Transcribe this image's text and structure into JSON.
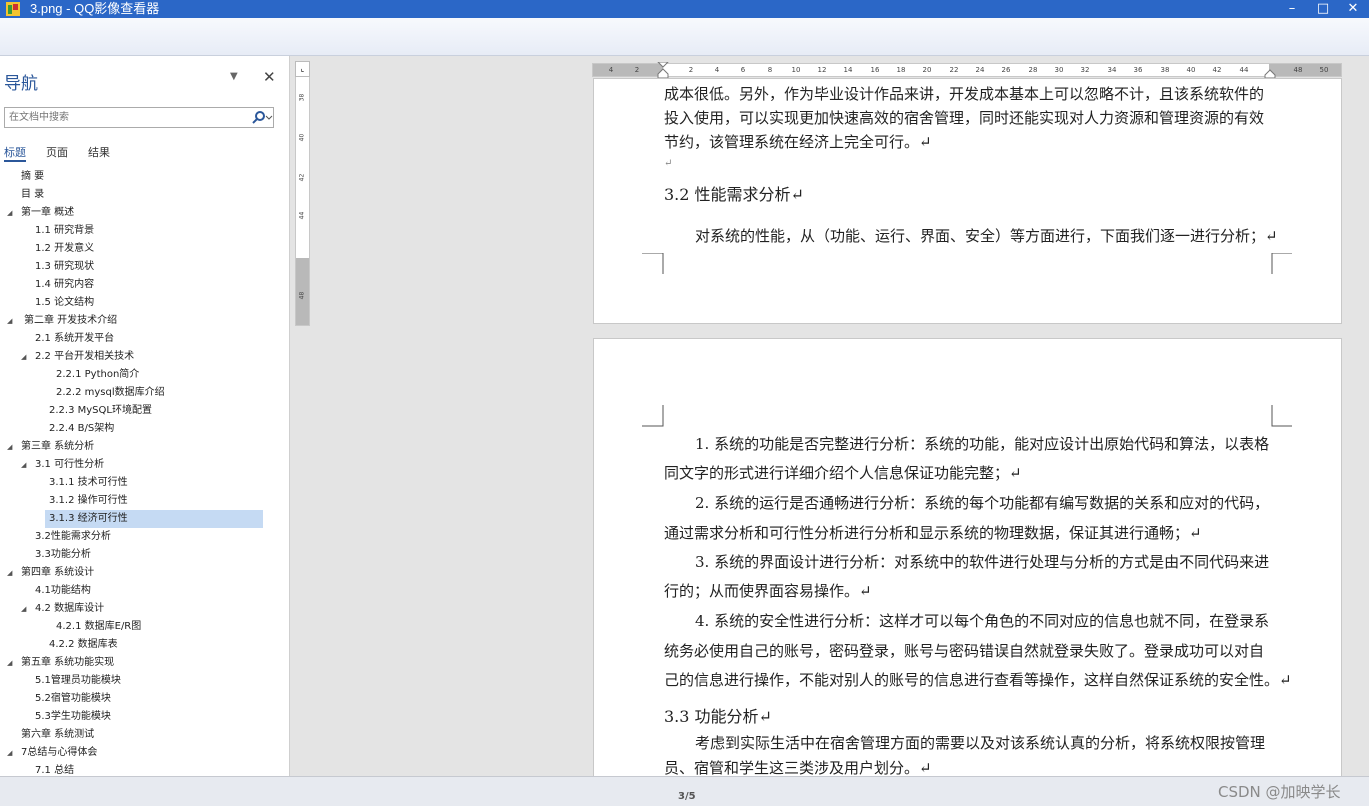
{
  "window": {
    "title": "3.png - QQ影像查看器",
    "minimize": "–",
    "maximize": "□",
    "close": "✕"
  },
  "nav": {
    "title": "导航",
    "search_placeholder": "在文档中搜索",
    "tabs": [
      "标题",
      "页面",
      "结果"
    ],
    "items": [
      {
        "label": "摘  要",
        "level": 1,
        "toggle": ""
      },
      {
        "label": "目  录",
        "level": 1,
        "toggle": ""
      },
      {
        "label": "第一章 概述",
        "level": 1,
        "toggle": "◢"
      },
      {
        "label": "1.1 研究背景",
        "level": 2,
        "toggle": ""
      },
      {
        "label": "1.2 开发意义",
        "level": 2,
        "toggle": ""
      },
      {
        "label": "1.3 研究现状",
        "level": 2,
        "toggle": ""
      },
      {
        "label": "1.4 研究内容",
        "level": 2,
        "toggle": ""
      },
      {
        "label": "1.5 论文结构",
        "level": 2,
        "toggle": ""
      },
      {
        "label": "第二章 开发技术介绍",
        "level": 1,
        "toggle": "◢"
      },
      {
        "label": "2.1 系统开发平台",
        "level": 2,
        "toggle": ""
      },
      {
        "label": "2.2 平台开发相关技术",
        "level": 2,
        "toggle": "◢"
      },
      {
        "label": "2.2.1   Python简介",
        "level": 4,
        "toggle": ""
      },
      {
        "label": "2.2.2   mysql数据库介绍",
        "level": 4,
        "toggle": ""
      },
      {
        "label": "2.2.3   MySQL环境配置",
        "level": 3,
        "toggle": ""
      },
      {
        "label": "2.2.4   B/S架构",
        "level": 3,
        "toggle": ""
      },
      {
        "label": "第三章 系统分析",
        "level": 1,
        "toggle": "◢"
      },
      {
        "label": "3.1 可行性分析",
        "level": 2,
        "toggle": "◢"
      },
      {
        "label": "3.1.1 技术可行性",
        "level": 3,
        "toggle": ""
      },
      {
        "label": "3.1.2 操作可行性",
        "level": 3,
        "toggle": ""
      },
      {
        "label": "3.1.3 经济可行性",
        "level": 3,
        "toggle": "",
        "selected": true
      },
      {
        "label": "3.2性能需求分析",
        "level": 2,
        "toggle": ""
      },
      {
        "label": "3.3功能分析",
        "level": 2,
        "toggle": ""
      },
      {
        "label": "第四章 系统设计",
        "level": 1,
        "toggle": "◢"
      },
      {
        "label": "4.1功能结构",
        "level": 2,
        "toggle": ""
      },
      {
        "label": "4.2 数据库设计",
        "level": 2,
        "toggle": "◢"
      },
      {
        "label": "4.2.1 数据库E/R图",
        "level": 4,
        "toggle": ""
      },
      {
        "label": "4.2.2 数据库表",
        "level": 3,
        "toggle": ""
      },
      {
        "label": "第五章 系统功能实现",
        "level": 1,
        "toggle": "◢"
      },
      {
        "label": "5.1管理员功能模块",
        "level": 2,
        "toggle": ""
      },
      {
        "label": "5.2宿管功能模块",
        "level": 2,
        "toggle": ""
      },
      {
        "label": "5.3学生功能模块",
        "level": 2,
        "toggle": ""
      },
      {
        "label": "第六章 系统测试",
        "level": 1,
        "toggle": ""
      },
      {
        "label": "7总结与心得体会",
        "level": 1,
        "toggle": "◢"
      },
      {
        "label": "7.1 总结",
        "level": 2,
        "toggle": ""
      }
    ]
  },
  "ruler_h": [
    "4",
    "2",
    "2",
    "4",
    "6",
    "8",
    "10",
    "12",
    "14",
    "16",
    "18",
    "20",
    "22",
    "24",
    "26",
    "28",
    "30",
    "32",
    "34",
    "36",
    "38",
    "40",
    "42",
    "44",
    "48",
    "50"
  ],
  "ruler_v": [
    "38",
    "40",
    "42",
    "44",
    "48"
  ],
  "page1": {
    "lines": [
      "成本很低。另外，作为毕业设计作品来讲，开发成本基本上可以忽略不计，且该系统软件的",
      "投入使用，可以实现更加快速高效的宿舍管理，同时还能实现对人力资源和管理资源的有效",
      "节约，该管理系统在经济上完全可行。↵",
      "↵"
    ],
    "heading": "3.2 性能需求分析↵",
    "para": "对系统的性能，从（功能、运行、界面、安全）等方面进行，下面我们逐一进行分析；↵"
  },
  "page2": {
    "lines": [
      "1. 系统的功能是否完整进行分析：系统的功能，能对应设计出原始代码和算法，以表格",
      "同文字的形式进行详细介绍个人信息保证功能完整；↵",
      "2. 系统的运行是否通畅进行分析：系统的每个功能都有编写数据的关系和应对的代码，",
      "通过需求分析和可行性分析进行分析和显示系统的物理数据，保证其进行通畅；↵",
      "3. 系统的界面设计进行分析：对系统中的软件进行处理与分析的方式是由不同代码来进",
      "行的；从而使界面容易操作。↵",
      "4. 系统的安全性进行分析：这样才可以每个角色的不同对应的信息也就不同，在登录系",
      "统务必使用自己的账号，密码登录，账号与密码错误自然就登录失败了。登录成功可以对自",
      "己的信息进行操作，不能对别人的账号的信息进行查看等操作，这样自然保证系统的安全性。↵"
    ],
    "heading": "3.3 功能分析↵",
    "para_lines": [
      "考虑到实际生活中在宿舍管理方面的需要以及对该系统认真的分析，将系统权限按管理",
      "员、宿管和学生这三类涉及用户划分。↵"
    ]
  },
  "status": {
    "page_indicator": "3/5",
    "watermark": "CSDN @加映学长"
  }
}
